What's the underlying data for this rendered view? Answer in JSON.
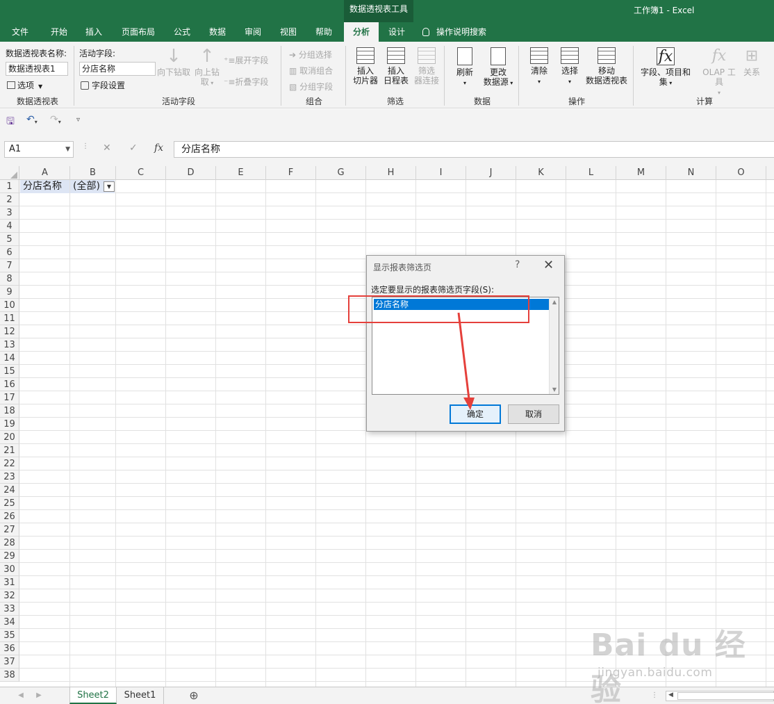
{
  "titlebar": {
    "context_tools": "数据透视表工具",
    "window_title": "工作簿1  -  Excel"
  },
  "tabs": [
    "文件",
    "开始",
    "插入",
    "页面布局",
    "公式",
    "数据",
    "审阅",
    "视图",
    "帮助",
    "分析",
    "设计"
  ],
  "active_tab": "分析",
  "tell_me": "操作说明搜索",
  "ribbon": {
    "pivot_name_label": "数据透视表名称:",
    "pivot_name_value": "数据透视表1",
    "options_label": "选项",
    "group_pivot": "数据透视表",
    "active_field_label": "活动字段:",
    "active_field_value": "分店名称",
    "field_settings": "字段设置",
    "drill_down": "向下钻取",
    "drill_up_1": "向上钻",
    "drill_up_2": "取",
    "expand_field": "展开字段",
    "collapse_field": "折叠字段",
    "group_active_field": "活动字段",
    "group_selection": "分组选择",
    "ungroup": "取消组合",
    "group_field": "分组字段",
    "group_group": "组合",
    "insert_slicer_1": "插入",
    "insert_slicer_2": "切片器",
    "insert_timeline_1": "插入",
    "insert_timeline_2": "日程表",
    "filter_conn_1": "筛选",
    "filter_conn_2": "器连接",
    "group_filter": "筛选",
    "refresh": "刷新",
    "change_source_1": "更改",
    "change_source_2": "数据源",
    "group_data": "数据",
    "clear": "清除",
    "select": "选择",
    "move_pivot_1": "移动",
    "move_pivot_2": "数据透视表",
    "group_actions": "操作",
    "fields_items_1": "字段、项目和",
    "fields_items_2": "集",
    "olap_tools": "OLAP 工具",
    "relationships": "关系",
    "group_calculations": "计算"
  },
  "formula_bar": {
    "name_box": "A1",
    "fx": "fx",
    "content": "分店名称"
  },
  "columns": [
    "A",
    "B",
    "C",
    "D",
    "E",
    "F",
    "G",
    "H",
    "I",
    "J",
    "K",
    "L",
    "M",
    "N",
    "O"
  ],
  "rows": [
    "1",
    "2",
    "3",
    "4",
    "5",
    "6",
    "7",
    "8",
    "9",
    "10",
    "11",
    "12",
    "13",
    "14",
    "15",
    "16",
    "17",
    "18",
    "19",
    "20",
    "21",
    "22",
    "23",
    "24",
    "25",
    "26",
    "27",
    "28",
    "29",
    "30",
    "31",
    "32",
    "33",
    "34",
    "35",
    "36",
    "37",
    "38"
  ],
  "cells": {
    "A1": "分店名称",
    "B1": "(全部)"
  },
  "sheets": [
    "Sheet2",
    "Sheet1"
  ],
  "active_sheet": "Sheet2",
  "dialog": {
    "title": "显示报表筛选页",
    "help": "?",
    "close": "✕",
    "prompt": "选定要显示的报表筛选页字段(S):",
    "items": [
      "分店名称"
    ],
    "ok": "确定",
    "cancel": "取消"
  },
  "annotation": {
    "color": "#e5403b"
  },
  "watermark": {
    "logo": "Bai du 经验",
    "url": "jingyan.baidu.com"
  },
  "colors": {
    "excel_green": "#217346",
    "selection_blue": "#0078d7",
    "ribbon_bg": "#f3f3f3"
  }
}
